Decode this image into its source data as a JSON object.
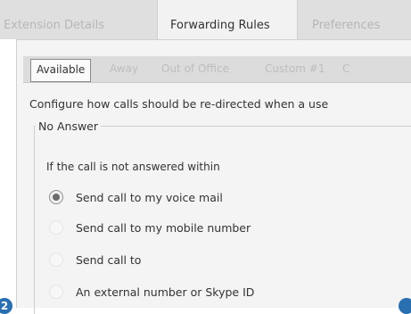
{
  "outer_tabs": [
    "Extension Details",
    "Forwarding Rules",
    "Preferences"
  ],
  "inner_tabs": [
    "Available",
    "Away",
    "Out of Office",
    "Custom #1",
    "C"
  ],
  "description": "Configure how calls should be re-directed when a use",
  "group_label": "No Answer",
  "prompt": "If the call is not answered within",
  "options": [
    {
      "label": "Send call to my voice mail",
      "checked": true
    },
    {
      "label": "Send call to my mobile number",
      "checked": false
    },
    {
      "label": "Send call to",
      "checked": false
    },
    {
      "label": "An external number or Skype ID",
      "checked": false
    }
  ],
  "badges": {
    "left": "2"
  }
}
